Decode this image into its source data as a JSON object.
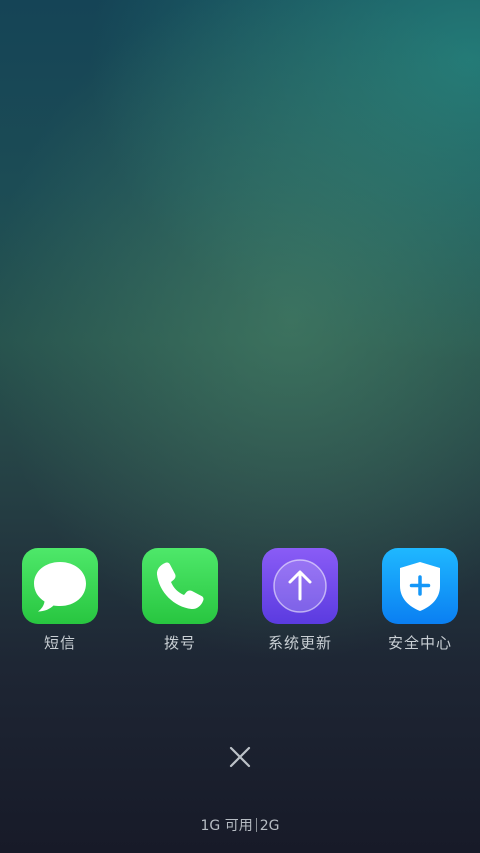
{
  "apps": [
    {
      "label": "短信",
      "icon": "message-bubble-icon",
      "color": "#34d058"
    },
    {
      "label": "拨号",
      "icon": "phone-icon",
      "color": "#34d058"
    },
    {
      "label": "系统更新",
      "icon": "arrow-up-icon",
      "color": "#6d48ea"
    },
    {
      "label": "安全中心",
      "icon": "shield-plus-icon",
      "color": "#1497f8"
    }
  ],
  "close_button": {
    "icon": "close-icon"
  },
  "memory": {
    "available_label": "1G 可用",
    "total_label": "2G"
  }
}
